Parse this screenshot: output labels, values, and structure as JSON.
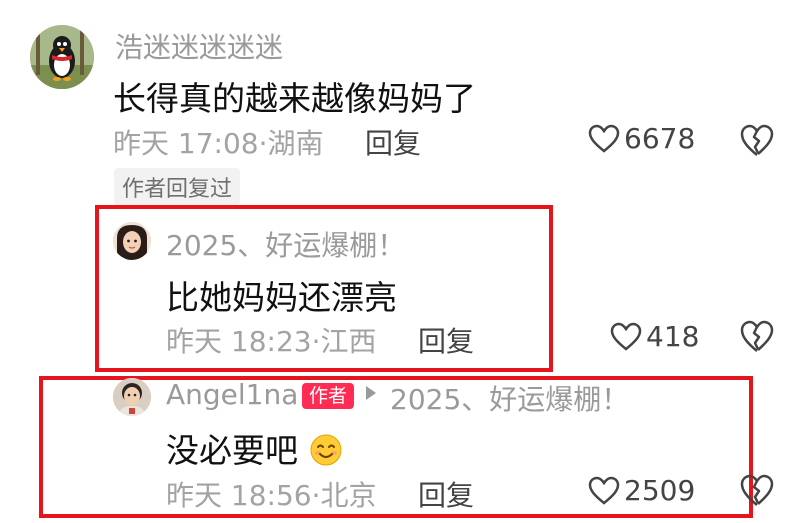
{
  "comments": [
    {
      "username": "浩迷迷迷迷迷",
      "text": "长得真的越来越像妈妈了",
      "meta": "昨天 17:08·湖南",
      "reply_label": "回复",
      "likes": "6678",
      "author_replied": "作者回复过"
    },
    {
      "username": "2025、好运爆棚！",
      "text": "比她妈妈还漂亮",
      "meta": "昨天 18:23·江西",
      "reply_label": "回复",
      "likes": "418"
    },
    {
      "username": "Angel1na",
      "author_badge": "作者",
      "reply_to": "2025、好运爆棚！",
      "text": "没必要吧",
      "emoji": "smiling-face-emoji",
      "meta": "昨天 18:56·北京",
      "reply_label": "回复",
      "likes": "2509"
    }
  ],
  "colors": {
    "highlight_box": "#e6141c",
    "author_badge": "#fe2c55",
    "meta_text": "#a3a3a3"
  }
}
